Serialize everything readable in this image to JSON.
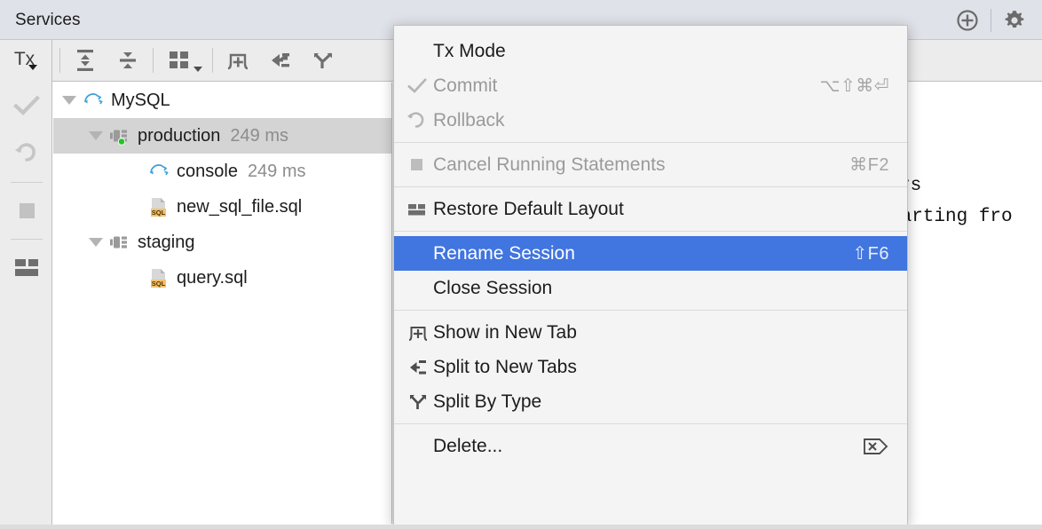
{
  "window": {
    "title": "Services",
    "actions": [
      {
        "name": "target-icon",
        "label": "Select Opened File"
      },
      {
        "name": "gear-icon",
        "label": "Settings"
      }
    ]
  },
  "left_toolbar": {
    "tx_label": "Tx",
    "items": [
      {
        "name": "tx-dropdown",
        "label": "Tx"
      },
      {
        "name": "commit-icon",
        "label": "Commit"
      },
      {
        "name": "rollback-icon",
        "label": "Rollback"
      },
      {
        "name": "stop-icon",
        "label": "Cancel Running Statements"
      },
      {
        "name": "restore-layout-icon",
        "label": "Restore Default Layout"
      }
    ]
  },
  "top_toolbar": {
    "items": [
      {
        "name": "expand-all-icon",
        "label": "Expand All"
      },
      {
        "name": "collapse-all-icon",
        "label": "Collapse All"
      },
      {
        "name": "layout-options-icon",
        "label": "Layout Options"
      },
      {
        "name": "show-in-new-tab-icon",
        "label": "Show in New Tab"
      },
      {
        "name": "split-to-new-tabs-icon",
        "label": "Split to New Tabs"
      },
      {
        "name": "split-by-type-icon",
        "label": "Split By Type"
      }
    ]
  },
  "tree": {
    "rows": [
      {
        "id": "mysql",
        "label": "MySQL",
        "time": "",
        "indent": 0,
        "arrow": "down",
        "icon": "mysql-dolphin-icon",
        "selected": false
      },
      {
        "id": "production",
        "label": "production",
        "time": "249 ms",
        "indent": 1,
        "arrow": "down",
        "icon": "session-connected-icon",
        "selected": true
      },
      {
        "id": "console",
        "label": "console",
        "time": "249 ms",
        "indent": 2,
        "arrow": "none",
        "icon": "mysql-dolphin-icon",
        "selected": false
      },
      {
        "id": "new_sql_file",
        "label": "new_sql_file.sql",
        "time": "",
        "indent": 2,
        "arrow": "none",
        "icon": "sql-file-icon",
        "selected": false
      },
      {
        "id": "staging",
        "label": "staging",
        "time": "",
        "indent": 1,
        "arrow": "down",
        "icon": "session-icon",
        "selected": false
      },
      {
        "id": "query",
        "label": "query.sql",
        "time": "",
        "indent": 2,
        "arrow": "none",
        "icon": "sql-file-icon",
        "selected": false
      }
    ]
  },
  "editor_background": {
    "line1": "rs",
    "line2": "tarting fro"
  },
  "context_menu": {
    "groups": [
      {
        "items": [
          {
            "label": "Tx Mode",
            "shortcut": "",
            "icon": "none",
            "disabled": false,
            "highlighted": false
          },
          {
            "label": "Commit",
            "shortcut": "⌥⇧⌘⏎",
            "icon": "check-icon",
            "disabled": true,
            "highlighted": false
          },
          {
            "label": "Rollback",
            "shortcut": "",
            "icon": "rollback-icon",
            "disabled": true,
            "highlighted": false
          }
        ]
      },
      {
        "items": [
          {
            "label": "Cancel Running Statements",
            "shortcut": "⌘F2",
            "icon": "stop-icon",
            "disabled": true,
            "highlighted": false
          }
        ]
      },
      {
        "items": [
          {
            "label": "Restore Default Layout",
            "shortcut": "",
            "icon": "restore-layout-icon",
            "disabled": false,
            "highlighted": false
          }
        ]
      },
      {
        "items": [
          {
            "label": "Rename Session",
            "shortcut": "⇧F6",
            "icon": "none",
            "disabled": false,
            "highlighted": true
          },
          {
            "label": "Close Session",
            "shortcut": "",
            "icon": "none",
            "disabled": false,
            "highlighted": false
          }
        ]
      },
      {
        "items": [
          {
            "label": "Show in New Tab",
            "shortcut": "",
            "icon": "show-in-new-tab-icon",
            "disabled": false,
            "highlighted": false
          },
          {
            "label": "Split to New Tabs",
            "shortcut": "",
            "icon": "split-to-new-tabs-icon",
            "disabled": false,
            "highlighted": false
          },
          {
            "label": "Split By Type",
            "shortcut": "",
            "icon": "split-by-type-icon",
            "disabled": false,
            "highlighted": false
          }
        ]
      },
      {
        "items": [
          {
            "label": "Delete...",
            "shortcut": "⌦",
            "icon": "none",
            "disabled": false,
            "highlighted": false
          }
        ]
      }
    ]
  },
  "colors": {
    "titlebar_bg": "#dfe2e8",
    "toolbar_bg": "#ececec",
    "menu_bg": "#f4f4f4",
    "highlight": "#4175df",
    "tree_selected": "#d4d4d4",
    "muted_text": "#8d8d8d",
    "status_green": "#22c522",
    "sql_badge": "#f5c26b"
  }
}
